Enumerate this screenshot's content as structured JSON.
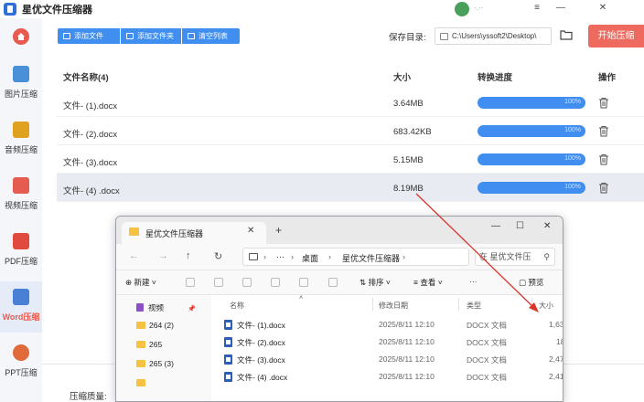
{
  "app": {
    "title": "星优文件压缩器",
    "user_name": "·.··"
  },
  "sidebar": {
    "items": [
      {
        "label": "图片压缩",
        "icon": "image-icon",
        "color": "#4a90d9"
      },
      {
        "label": "音频压缩",
        "icon": "audio-icon",
        "color": "#e0a020"
      },
      {
        "label": "视频压缩",
        "icon": "video-icon",
        "color": "#e55b4f"
      },
      {
        "label": "PDF压缩",
        "icon": "pdf-icon",
        "color": "#e04a3f"
      },
      {
        "label": "Word压缩",
        "icon": "word-icon",
        "color": "#4a7fd6",
        "active": true
      },
      {
        "label": "PPT压缩",
        "icon": "ppt-icon",
        "color": "#e06a3a"
      }
    ]
  },
  "toolbar": {
    "add_file": "添加文件",
    "add_folder": "添加文件夹",
    "clear_list": "清空列表",
    "save_dir_label": "保存目录:",
    "save_dir_value": "C:\\Users\\yssoft2\\Desktop\\",
    "start_button": "开始压缩"
  },
  "table": {
    "headers": {
      "name": "文件名称(4)",
      "size": "大小",
      "progress": "转换进度",
      "action": "操作"
    },
    "rows": [
      {
        "name": "文件- (1).docx",
        "size": "3.64MB",
        "progress": "100%"
      },
      {
        "name": "文件- (2).docx",
        "size": "683.42KB",
        "progress": "100%"
      },
      {
        "name": "文件- (3).docx",
        "size": "5.15MB",
        "progress": "100%"
      },
      {
        "name": "文件- (4) .docx",
        "size": "8.19MB",
        "progress": "100%"
      }
    ]
  },
  "settings": {
    "quality_label": "压缩质量:"
  },
  "explorer": {
    "tab_title": "星优文件压缩器",
    "breadcrumb": [
      "桌面",
      "星优文件压缩器"
    ],
    "search_placeholder": "在 星优文件压",
    "commands": {
      "new": "新建",
      "sort": "排序",
      "view": "查看",
      "more": "···",
      "preview": "预览"
    },
    "nav_items": [
      "视频",
      "264 (2)",
      "265",
      "265 (3)"
    ],
    "columns": {
      "name": "名称",
      "modified": "修改日期",
      "type": "类型",
      "size": "大小"
    },
    "files": [
      {
        "name": "文件- (1).docx",
        "modified": "2025/8/11 12:10",
        "type": "DOCX 文档",
        "size": "1,63"
      },
      {
        "name": "文件- (2).docx",
        "modified": "2025/8/11 12:10",
        "type": "DOCX 文档",
        "size": "18"
      },
      {
        "name": "文件- (3).docx",
        "modified": "2025/8/11 12:10",
        "type": "DOCX 文档",
        "size": "2,47"
      },
      {
        "name": "文件- (4) .docx",
        "modified": "2025/8/11 12:10",
        "type": "DOCX 文档",
        "size": "2,41"
      }
    ]
  },
  "colors": {
    "accent": "#3f8ef0",
    "start": "#ee6a5f",
    "active_text": "#e85a4f",
    "annotation": "#d9342b"
  }
}
